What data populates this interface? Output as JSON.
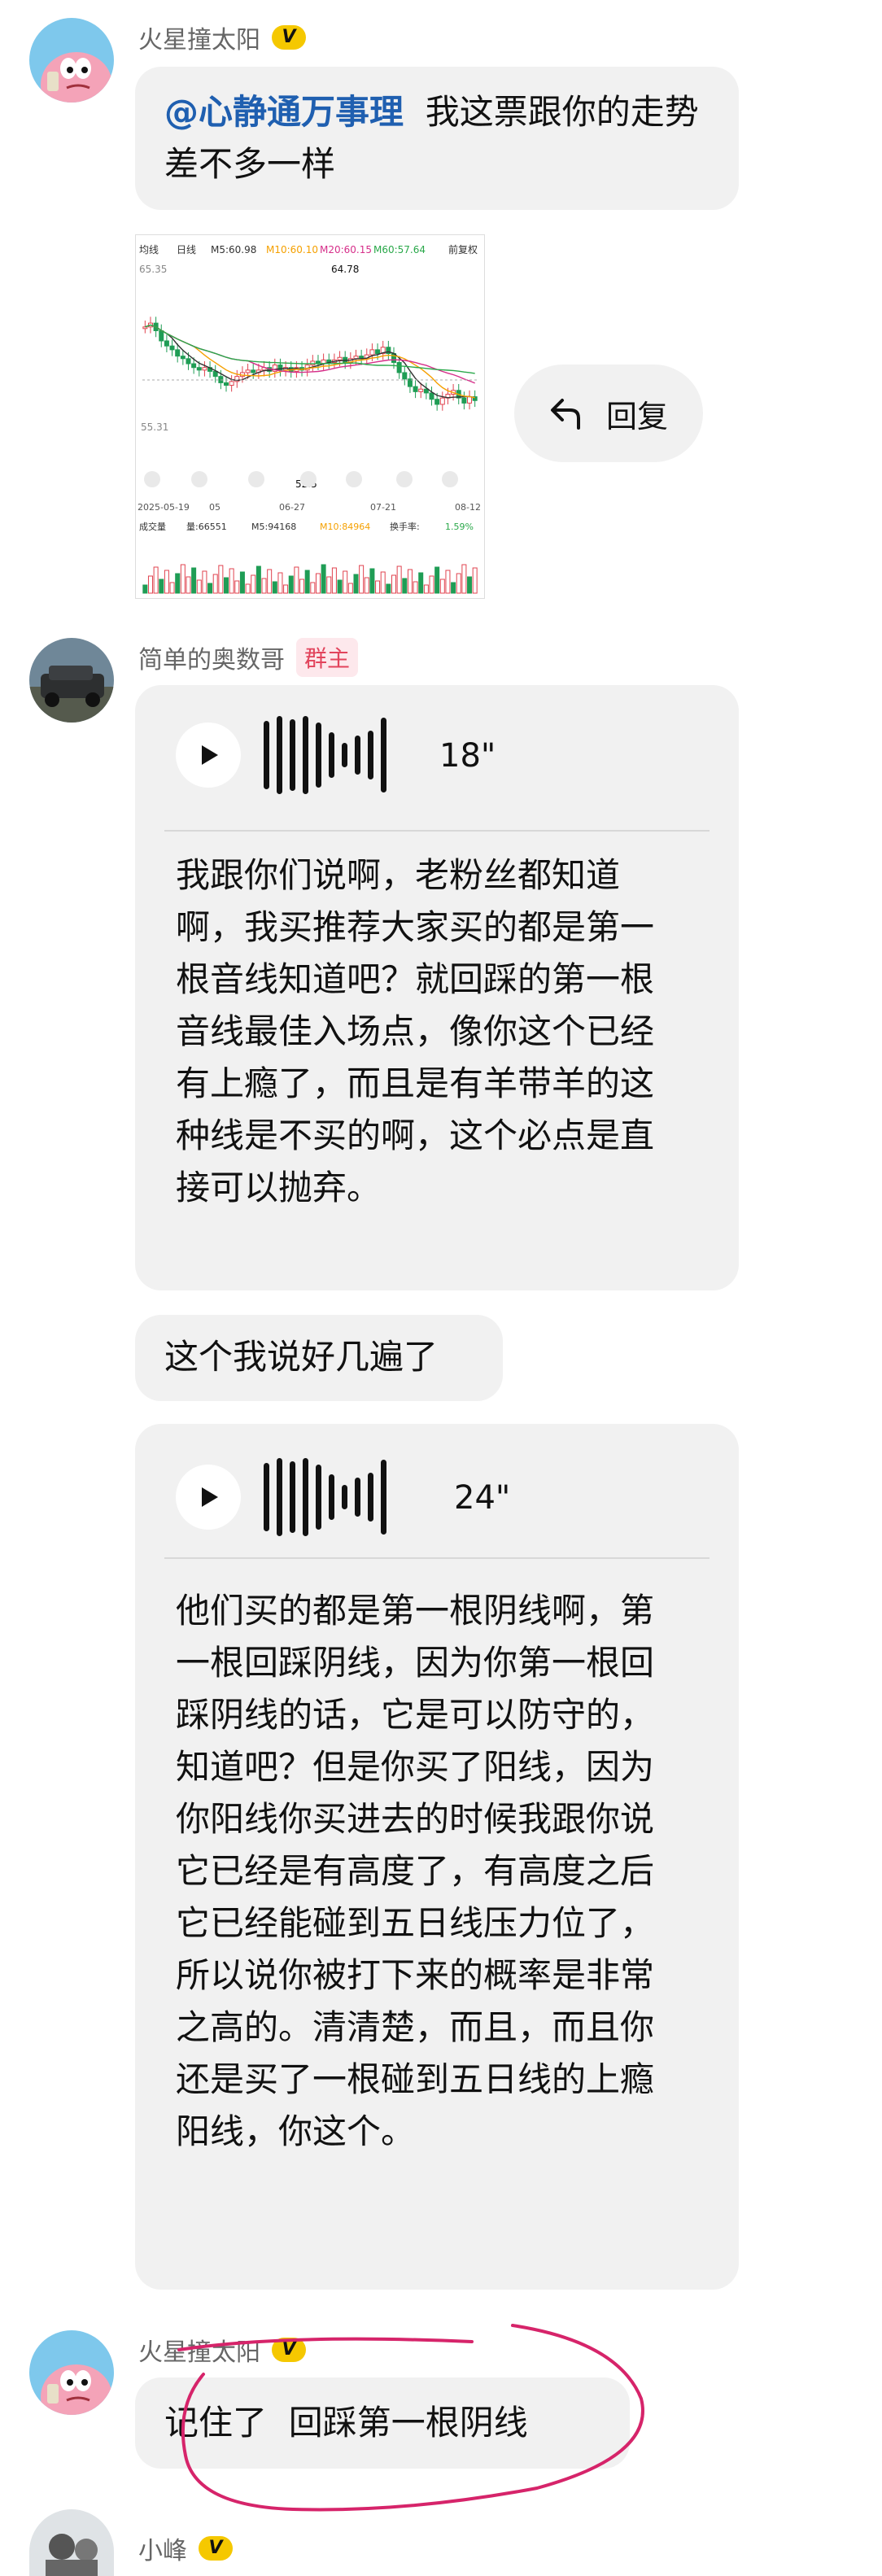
{
  "messages": [
    {
      "user": "火星撞太阳",
      "badge": "V",
      "mention": "@心静通万事理",
      "text": "我这票跟你的走势差不多一样"
    },
    {
      "user": "简单的奥数哥",
      "role": "群主",
      "voice1": {
        "duration": "18\"",
        "transcript": "我跟你们说啊，老粉丝都知道啊，我买推荐大家买的都是第一根音线知道吧？就回踩的第一根音线最佳入场点，像你这个已经有上瘾了，而且是有羊带羊的这种线是不买的啊，这个必点是直接可以抛弃。"
      },
      "text": "这个我说好几遍了",
      "voice2": {
        "duration": "24\"",
        "transcript": "他们买的都是第一根阴线啊，第一根回踩阴线，因为你第一根回踩阴线的话，它是可以防守的，知道吧？但是你买了阳线，因为你阳线你买进去的时候我跟你说它已经是有高度了，有高度之后它已经能碰到五日线压力位了，所以说你被打下来的概率是非常之高的。清清楚，而且，而且你还是买了一根碰到五日线的上瘾阳线，你这个。"
      }
    },
    {
      "user": "火星撞太阳",
      "badge": "V",
      "text": "记住了  回踩第一根阴线"
    },
    {
      "user": "小峰",
      "badge": "V"
    }
  ],
  "reply_label": "回复",
  "chart": {
    "toolbar_left": [
      "均线",
      "日线",
      "M5:60.98",
      "M10:60.10",
      "M20:60.15",
      "M60:57.64"
    ],
    "toolbar_right": "前复权",
    "high_label": "64.78",
    "y_top": "65.35",
    "y_mid": "55.31",
    "low_label": "52.5",
    "dates": [
      "2025-05-19",
      "05",
      "06-27",
      "07-21",
      "08-12"
    ],
    "vol_labels": [
      "成交量",
      "量:66551",
      "M5:94168",
      "M10:84964",
      "换手率:",
      "1.59%"
    ],
    "vol_label_colors": [
      "#333",
      "#333",
      "#333",
      "#f5a000",
      "#333",
      "#2aa84a"
    ]
  }
}
